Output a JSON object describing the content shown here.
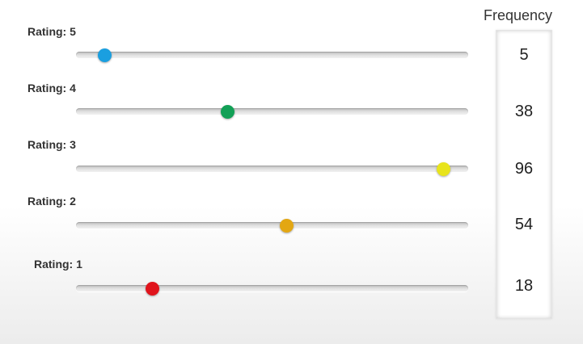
{
  "frequency_header": "Frequency",
  "sliders": [
    {
      "label": "Rating: 5",
      "value": 5,
      "max": 100,
      "color": "#1a9fe0"
    },
    {
      "label": "Rating: 4",
      "value": 38,
      "max": 100,
      "color": "#12a056"
    },
    {
      "label": "Rating: 3",
      "value": 96,
      "max": 100,
      "color": "#e8e41c"
    },
    {
      "label": "Rating: 2",
      "value": 54,
      "max": 100,
      "color": "#e3a713"
    },
    {
      "label": "Rating: 1",
      "value": 18,
      "max": 100,
      "color": "#e0141c"
    }
  ],
  "frequencies": [
    "5",
    "38",
    "96",
    "54",
    "18"
  ]
}
